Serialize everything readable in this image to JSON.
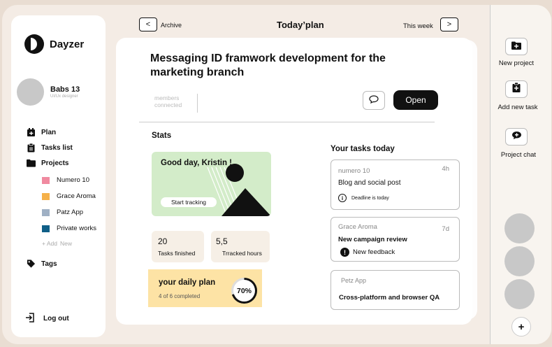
{
  "app": {
    "name": "Dayzer"
  },
  "profile": {
    "name": "Babs 13",
    "role": "UI/Ux designer"
  },
  "nav": {
    "plan": "Plan",
    "tasks_list": "Tasks list",
    "projects": "Projects",
    "project_items": [
      {
        "label": "Numero 10",
        "color": "#f08aa0"
      },
      {
        "label": "Grace Aroma",
        "color": "#f5b14a"
      },
      {
        "label": "Patz App",
        "color": "#9fb0c4"
      },
      {
        "label": "Private works",
        "color": "#0f5f87"
      }
    ],
    "add_prefix": "+ Add",
    "add_new": "New",
    "tags": "Tags",
    "logout": "Log out"
  },
  "topbar": {
    "archive": "Archive",
    "title": "Today’plan",
    "this_week": "This week",
    "prev_icon": "chevron-left-icon",
    "next_icon": "chevron-right-icon"
  },
  "main": {
    "title": "Messaging   ID framwork development for  the marketing branch",
    "members_label": "members connected",
    "open_button": "Open",
    "stats_heading": "Stats",
    "greeting": "Good day, Kristin !",
    "start_tracking": "Start tracking",
    "tasks_finished": {
      "value": "20",
      "label": "Tasks finished"
    },
    "tracked_hours": {
      "value": "5,5",
      "label": "Trracked hours"
    },
    "daily_plan": {
      "title": "your daily plan",
      "subtitle": "4 of 6 completed",
      "percent_label": "70%",
      "progress": 0.7
    },
    "tasks_heading": "Your tasks today",
    "tasks": [
      {
        "project": "numero 10",
        "time": "4h",
        "title": "Blog  and  social  post",
        "note": "Deadline is today"
      },
      {
        "project": "Grace Aroma",
        "time": "7d",
        "title": "New campaign review",
        "note": "New feedback"
      },
      {
        "project": "Petz App",
        "title": "Cross-platform and browser QA"
      }
    ]
  },
  "rail": {
    "new_project": "New project",
    "add_task": "Add new task",
    "project_chat": "Project chat",
    "add_icon": "plus-icon"
  },
  "colors": {
    "accent_green": "#d3ecc9",
    "accent_yellow": "#fde3a5",
    "stat_bg": "#f6efe6"
  }
}
